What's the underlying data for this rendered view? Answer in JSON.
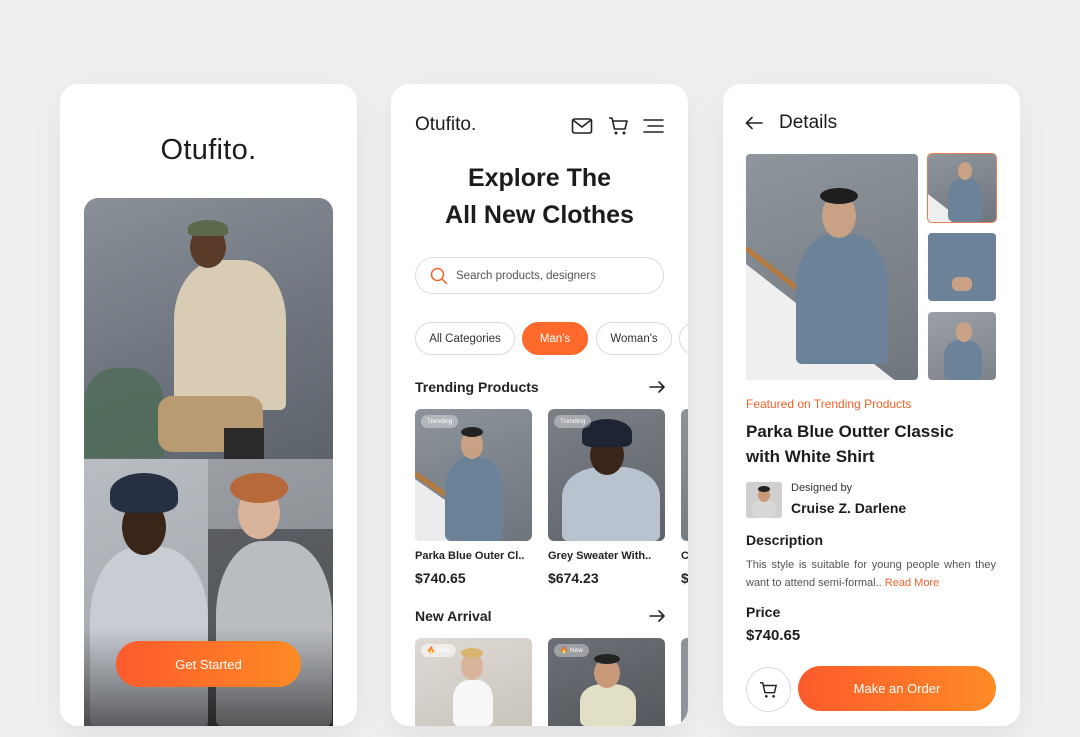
{
  "colors": {
    "accent": "#fd6a2b",
    "background": "#efefef",
    "card": "#ffffff",
    "text": "#1c1c1c"
  },
  "splash": {
    "logo": "Otufito.",
    "cta": "Get Started"
  },
  "home": {
    "logo": "Otufito.",
    "icons": [
      "mail-icon",
      "cart-icon",
      "menu-icon"
    ],
    "title_line1": "Explore The",
    "title_line2": "All New Clothes",
    "search_placeholder": "Search products, designers",
    "categories": [
      "All Categories",
      "Man's",
      "Woman's"
    ],
    "selected_category": "Man's",
    "trending": {
      "title": "Trending Products",
      "items": [
        {
          "tag": "Trending",
          "name": "Parka Blue Outer Cl..",
          "price": "$740.65"
        },
        {
          "tag": "Trending",
          "name": "Grey Sweater With..",
          "price": "$674.23"
        },
        {
          "tag": "",
          "name": "C",
          "price": "$"
        }
      ]
    },
    "new_arrival": {
      "title": "New Arrival",
      "items": [
        {
          "tag": "🔥 New"
        },
        {
          "tag": "🔥 New"
        }
      ]
    }
  },
  "details": {
    "title": "Details",
    "featured": "Featured on Trending Products",
    "name_line1": "Parka Blue Outter Classic",
    "name_line2": "with White Shirt",
    "designed_by_label": "Designed by",
    "designer": "Cruise Z. Darlene",
    "description_title": "Description",
    "description": "This style is suitable for young people when they want to attend semi-formal..",
    "read_more": "Read More",
    "price_title": "Price",
    "price": "$740.65",
    "order_cta": "Make an Order"
  }
}
